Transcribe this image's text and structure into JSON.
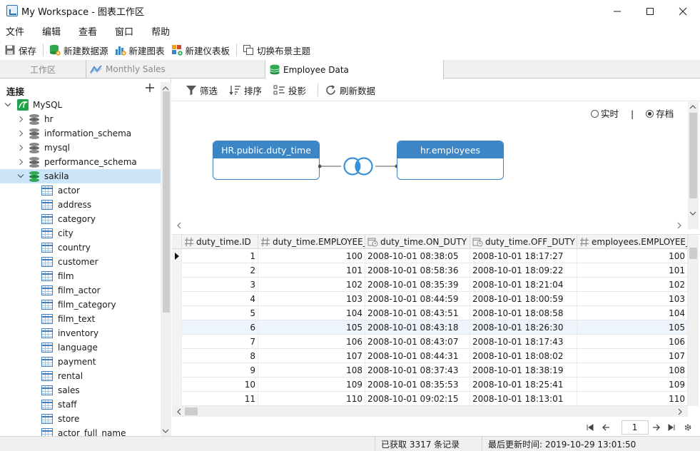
{
  "window": {
    "title": "My Workspace - 图表工作区"
  },
  "menu": [
    "文件",
    "编辑",
    "查看",
    "窗口",
    "帮助"
  ],
  "toolbar": {
    "save": "保存",
    "new_datasource": "新建数据源",
    "new_chart": "新建图表",
    "new_dashboard": "新建仪表板",
    "toggle_theme": "切换布景主题"
  },
  "tabs": [
    {
      "label": "工作区",
      "active": false
    },
    {
      "label": "Monthly Sales",
      "active": false
    },
    {
      "label": "Employee Data",
      "active": true
    }
  ],
  "connections": {
    "title": "连接",
    "root": "MySQL",
    "databases": [
      "hr",
      "information_schema",
      "mysql",
      "performance_schema",
      "sakila"
    ],
    "tables": [
      "actor",
      "address",
      "category",
      "city",
      "country",
      "customer",
      "film",
      "film_actor",
      "film_category",
      "film_text",
      "inventory",
      "language",
      "payment",
      "rental",
      "sales",
      "staff",
      "store",
      "actor_full_name"
    ]
  },
  "sub_toolbar": {
    "filter": "筛选",
    "sort": "排序",
    "projection": "投影",
    "refresh": "刷新数据"
  },
  "designer": {
    "mode_realtime": "实时",
    "mode_separator": "|",
    "mode_archive": "存档",
    "left_table": "HR.public.duty_time",
    "right_table": "hr.employees"
  },
  "grid": {
    "columns": [
      "duty_time.ID",
      "duty_time.EMPLOYEE_ID",
      "duty_time.ON_DUTY",
      "duty_time.OFF_DUTY",
      "employees.EMPLOYEE_ID"
    ],
    "rows": [
      [
        "1",
        "100",
        "2008-10-01 08:38:05",
        "2008-10-01 18:17:27",
        "100"
      ],
      [
        "2",
        "101",
        "2008-10-01 08:58:36",
        "2008-10-01 18:09:22",
        "101"
      ],
      [
        "3",
        "102",
        "2008-10-01 08:35:39",
        "2008-10-01 18:21:04",
        "102"
      ],
      [
        "4",
        "103",
        "2008-10-01 08:44:59",
        "2008-10-01 18:00:59",
        "103"
      ],
      [
        "5",
        "104",
        "2008-10-01 08:43:51",
        "2008-10-01 18:08:58",
        "104"
      ],
      [
        "6",
        "105",
        "2008-10-01 08:43:18",
        "2008-10-01 18:26:30",
        "105"
      ],
      [
        "7",
        "106",
        "2008-10-01 08:43:07",
        "2008-10-01 18:17:43",
        "106"
      ],
      [
        "8",
        "107",
        "2008-10-01 08:44:31",
        "2008-10-01 18:08:02",
        "107"
      ],
      [
        "9",
        "108",
        "2008-10-01 08:37:43",
        "2008-10-01 18:38:19",
        "108"
      ],
      [
        "10",
        "109",
        "2008-10-01 08:35:53",
        "2008-10-01 18:25:41",
        "109"
      ],
      [
        "11",
        "110",
        "2008-10-01 09:02:15",
        "2008-10-01 18:13:01",
        "110"
      ]
    ]
  },
  "pager": {
    "page": "1"
  },
  "status": {
    "records": "已获取 3317 条记录",
    "last_updated": "最后更新时间: 2019-10-29 13:01:50"
  },
  "colors": {
    "accent": "#3d86c6",
    "selection": "#cce4f7",
    "db_green": "#1fa34a"
  }
}
